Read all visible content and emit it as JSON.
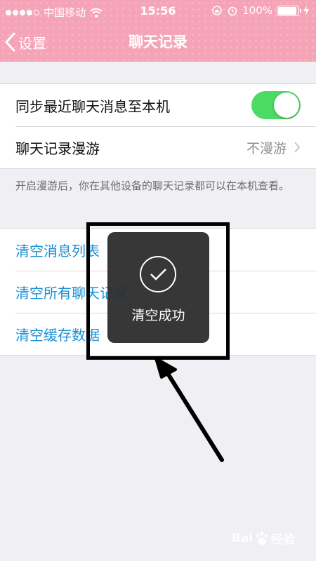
{
  "status_bar": {
    "carrier": "中国移动",
    "time": "15:56",
    "battery": "100%",
    "battery_level": 1.0
  },
  "nav": {
    "back_label": "设置",
    "title": "聊天记录"
  },
  "settings": {
    "sync_label": "同步最近聊天消息至本机",
    "sync_on": true,
    "roaming_label": "聊天记录漫游",
    "roaming_value": "不漫游",
    "roaming_note": "开启漫游后，你在其他设备的聊天记录都可以在本机查看。"
  },
  "actions": {
    "clear_list": "清空消息列表",
    "clear_all": "清空所有聊天记录",
    "clear_cache": "清空缓存数据"
  },
  "toast": {
    "message": "清空成功"
  },
  "watermark": {
    "text_left": "Bai",
    "text_right": "经验"
  },
  "colors": {
    "header": "#f5a3b6",
    "toggle_on": "#4cd964",
    "action_text": "#1a8fd6"
  }
}
